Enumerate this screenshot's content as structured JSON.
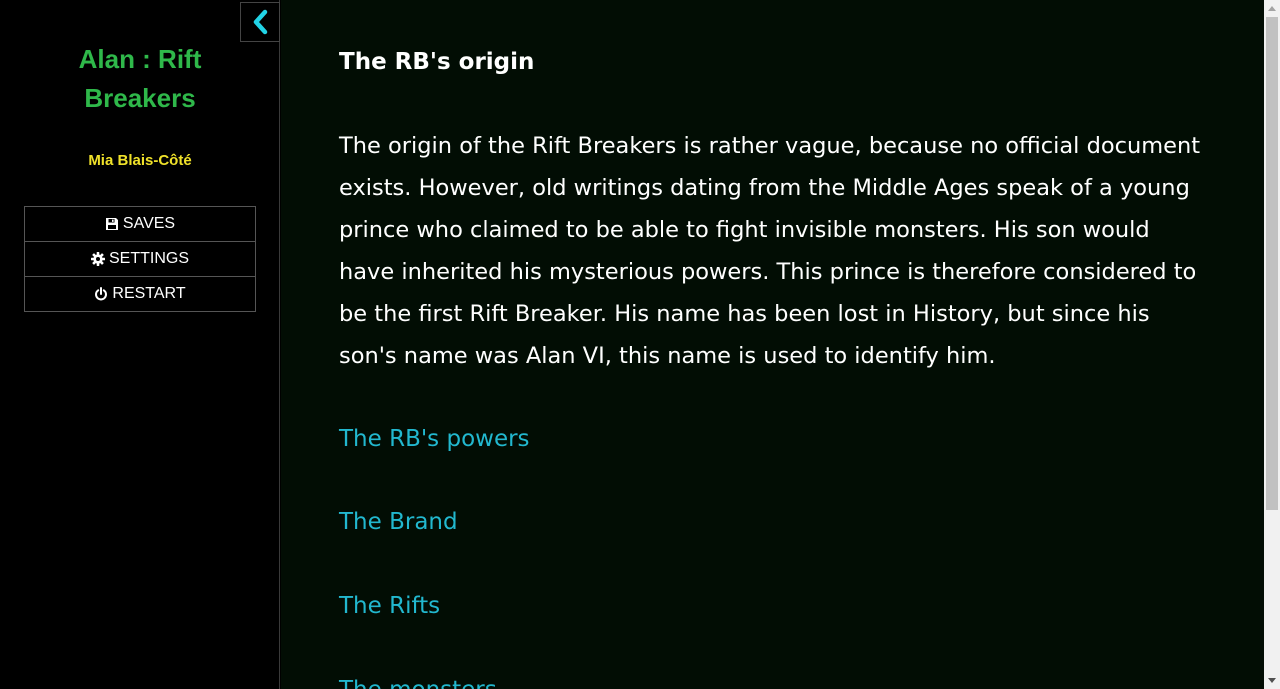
{
  "sidebar": {
    "title_line1": "Alan : Rift",
    "title_line2": "Breakers",
    "author": "Mia Blais-Côté",
    "menu": {
      "saves_label": "SAVES",
      "settings_label": "SETTINGS",
      "restart_label": "RESTART"
    }
  },
  "passage": {
    "heading": "The RB's origin",
    "body": "The origin of the Rift Breakers is rather vague, because no official document exists. However, old writings dating from the Middle Ages speak of a young prince who claimed to be able to fight invisible monsters. His son would have inherited his mysterious powers. This prince is therefore considered to be the first Rift Breaker. His name has been lost in History, but since his son's name was Alan VI, this name is used to identify him.",
    "links": [
      "The RB's powers",
      "The Brand",
      "The Rifts",
      "The monsters"
    ]
  },
  "colors": {
    "title": "#2fb84a",
    "author": "#f0e22a",
    "link": "#22b8cf",
    "toggle_icon": "#22d3e6",
    "passage_bg": "#020d04"
  },
  "icons": {
    "toggle": "chevron-left-icon",
    "saves": "floppy-disk-icon",
    "settings": "gear-icon",
    "restart": "power-icon"
  }
}
